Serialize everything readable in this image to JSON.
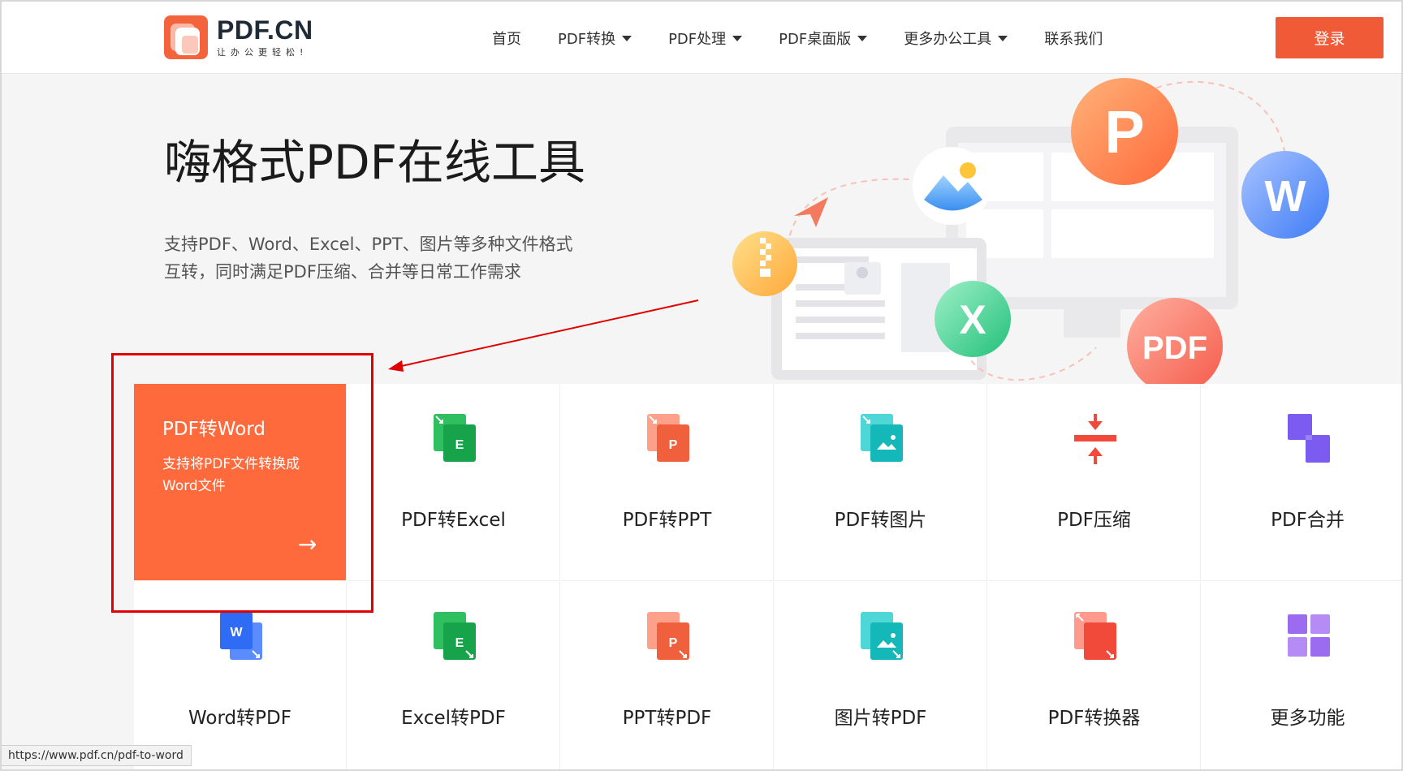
{
  "header": {
    "logo_title": "PDF.CN",
    "logo_subtitle": "让办公更轻松!",
    "nav": [
      {
        "label": "首页",
        "has_dropdown": false
      },
      {
        "label": "PDF转换",
        "has_dropdown": true
      },
      {
        "label": "PDF处理",
        "has_dropdown": true
      },
      {
        "label": "PDF桌面版",
        "has_dropdown": true
      },
      {
        "label": "更多办公工具",
        "has_dropdown": true
      },
      {
        "label": "联系我们",
        "has_dropdown": false
      }
    ],
    "login_label": "登录"
  },
  "hero": {
    "title": "嗨格式PDF在线工具",
    "description_line1": "支持PDF、Word、Excel、PPT、图片等多种文件格式",
    "description_line2": "互转，同时满足PDF压缩、合并等日常工作需求",
    "illustration_badges": [
      "P",
      "W",
      "X",
      "PDF"
    ]
  },
  "featured_tool": {
    "title": "PDF转Word",
    "description": "支持将PDF文件转换成Word文件",
    "arrow": "→"
  },
  "tools": [
    {
      "label": "PDF转Excel",
      "icon": "excel-icon",
      "glyph": "E"
    },
    {
      "label": "PDF转PPT",
      "icon": "ppt-icon",
      "glyph": "P"
    },
    {
      "label": "PDF转图片",
      "icon": "image-icon",
      "glyph": ""
    },
    {
      "label": "PDF压缩",
      "icon": "compress-icon",
      "glyph": ""
    },
    {
      "label": "PDF合并",
      "icon": "merge-icon",
      "glyph": ""
    },
    {
      "label": "Word转PDF",
      "icon": "word-icon",
      "glyph": "W"
    },
    {
      "label": "Excel转PDF",
      "icon": "excel-icon",
      "glyph": "E"
    },
    {
      "label": "PPT转PDF",
      "icon": "ppt-icon",
      "glyph": "P"
    },
    {
      "label": "图片转PDF",
      "icon": "image-icon",
      "glyph": ""
    },
    {
      "label": "PDF转换器",
      "icon": "converter-icon",
      "glyph": ""
    },
    {
      "label": "更多功能",
      "icon": "more-icon",
      "glyph": ""
    }
  ],
  "colors": {
    "brand": "#f05a37",
    "featured": "#ff6a3d",
    "annotation": "#e00000",
    "excel": "#16a34a",
    "ppt": "#f0603c",
    "image": "#14b8b8",
    "word": "#2f6cf6",
    "merge": "#7c5cf0"
  },
  "statusbar": {
    "url": "https://www.pdf.cn/pdf-to-word"
  }
}
